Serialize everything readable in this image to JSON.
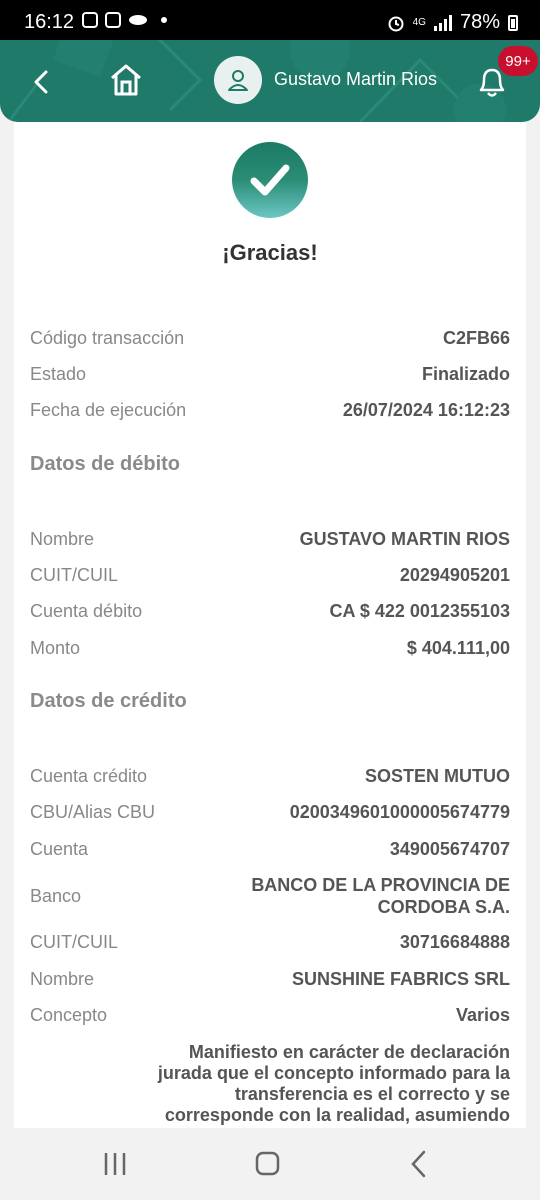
{
  "status_bar": {
    "time": "16:12",
    "network": "4G",
    "battery": "78%"
  },
  "header": {
    "user_name": "Gustavo Martin Rios",
    "notification_badge": "99+",
    "accent_color": "#1f7a6a"
  },
  "confirmation": {
    "title": "¡Gracias!"
  },
  "summary": [
    {
      "label": "Código transacción",
      "value": "C2FB66"
    },
    {
      "label": "Estado",
      "value": "Finalizado"
    },
    {
      "label": "Fecha de ejecución",
      "value": "26/07/2024 16:12:23"
    }
  ],
  "debit": {
    "title": "Datos de débito",
    "rows": [
      {
        "label": "Nombre",
        "value": "GUSTAVO MARTIN RIOS"
      },
      {
        "label": "CUIT/CUIL",
        "value": "20294905201"
      },
      {
        "label": "Cuenta débito",
        "value": "CA $ 422 0012355103"
      },
      {
        "label": "Monto",
        "value": "$ 404.111,00"
      }
    ]
  },
  "credit": {
    "title": "Datos de crédito",
    "rows": [
      {
        "label": "Cuenta crédito",
        "value": "SOSTEN MUTUO"
      },
      {
        "label": "CBU/Alias CBU",
        "value": "0200349601000005674779"
      },
      {
        "label": "Cuenta",
        "value": "349005674707"
      },
      {
        "label": "Banco",
        "value": "BANCO DE LA PROVINCIA DE CORDOBA S.A."
      },
      {
        "label": "CUIT/CUIL",
        "value": "30716684888"
      },
      {
        "label": "Nombre",
        "value": "SUNSHINE FABRICS SRL"
      },
      {
        "label": "Concepto",
        "value": "Varios"
      }
    ],
    "legal_text": "Manifiesto en carácter de declaración jurada que el concepto informado para la transferencia es el correcto y se corresponde con la realidad, asumiendo"
  }
}
